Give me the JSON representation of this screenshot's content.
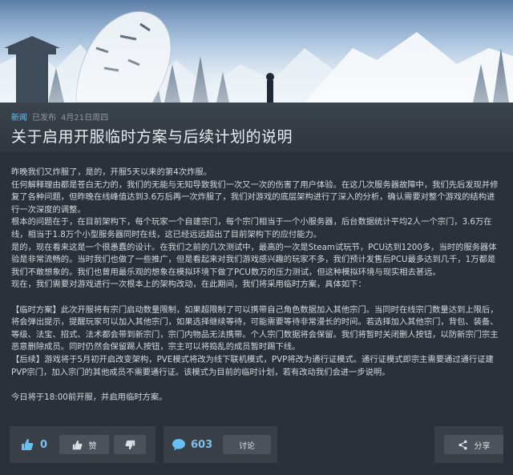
{
  "header": {
    "tag": "新闻",
    "status": "已发布",
    "date": "4月21日周四",
    "title": "关于启用开服临时方案与后续计划的说明"
  },
  "body": {
    "paragraphs": [
      "昨晚我们又炸服了，是的，开服5天以来的第4次炸服。",
      "任何解释理由都是苍白无力的，我们的无能与无知导致我们一次又一次的伤害了用户体验。在这几次服务器故障中，我们先后发现并修复了各种问题，但昨晚在线峰值达到3.6万后再一次炸服了，我们对游戏的底层架构进行了深入的分析，确认需要对整个游戏的结构进行一次深度的调整。",
      "根本的问题在于，在目前架构下，每个玩家一个自建宗门，每个宗门相当于一个小服务器，后台数据统计平均2人一个宗门，3.6万在线，相当于1.8万个小型服务器同时在线，这已经远远超出了目前架构下的应付能力。",
      "是的，现在看来这是一个很愚蠢的设计。在我们之前的几次测试中，最高的一次是Steam试玩节，PCU达到1200多，当时的服务器体验是非常流畅的。当时我们也做了一些推广，但是看起来对我们游戏感兴趣的玩家不多，我们预计发售后PCU最多达到几千，1万都是我们不敢想象的。我们也曾用最乐观的想象在模拟环境下做了PCU数万的压力测试，但这种模拟环境与现实相去甚远。",
      "现在，我们需要对游戏进行一次根本上的架构改动，在此期间，我们将采用临时方案，具体如下：",
      "",
      "【临时方案】此次开服将有宗门启动数量限制，如果超限制了可以携带自己角色数据加入其他宗门。当同时在线宗门数量达到上限后，将会弹出提示，提醒玩家可以加入其他宗门，如果选择继续等待，可能需要等待非常漫长的时间。若选择加入其他宗门，背包、装备、等级、法宝、招式、法术都会带到新宗门，宗门内物品无法携带。个人宗门数据将会保留。我们将暂时关闭删人按钮，以防新宗门宗主恶意删除成员。同时仍然会保留踢人按钮，宗主可以将捣乱的成员暂时踢下线。",
      "【后续】游戏将于5月初开启改变架构，PVE模式将改为线下联机模式，PVP将改为通行证模式。通行证模式即宗主需要通过通行证建PVP宗门，加入宗门的其他成员不需要通行证。该模式为目前的临时计划，若有改动我们会进一步说明。",
      "",
      "今日将于18:00前开服，并启用临时方案。"
    ]
  },
  "actions": {
    "like_count": "0",
    "like_label": "赞",
    "comment_count": "603",
    "comment_label": "讨论",
    "share_label": "分享"
  },
  "icons": [
    "thumbs-up-icon",
    "thumbs-down-icon",
    "comment-icon",
    "share-icon"
  ],
  "colors": {
    "accent": "#66c0f4",
    "background": "#2b3138"
  }
}
